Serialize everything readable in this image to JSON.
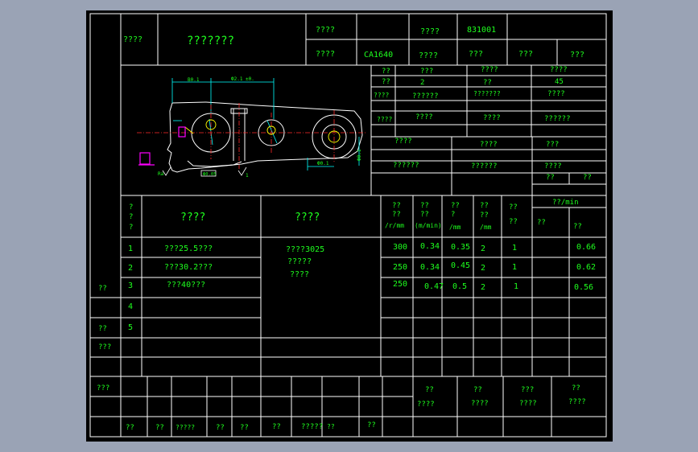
{
  "header": {
    "card_title": "????",
    "process_name": "???????",
    "product_model_label": "????",
    "product_model_value": "",
    "part_number_label": "????",
    "part_number_value": "831001",
    "product_name_label": "????",
    "product_name_value": "CA1640",
    "part_name_label": "????",
    "part_name_value": "???",
    "sheet_label": "???",
    "page_label": "???"
  },
  "info": {
    "r1": [
      "??",
      "???",
      "????",
      "????"
    ],
    "r2": [
      "??",
      "2",
      "??",
      "45"
    ],
    "r3": [
      "????",
      "??????",
      "???????",
      "????"
    ],
    "r4": [
      "????",
      "????",
      "????",
      "??????"
    ],
    "r5": [
      "????",
      "????",
      "???"
    ],
    "r6": [
      "??????",
      "??????",
      "????"
    ],
    "r7": [
      "??",
      "??"
    ]
  },
  "drawing": {
    "dim_left": "B0.1",
    "dim_top": "Ф2.1 ±0.",
    "dim_right": "Ф0.1",
    "dim_vertical": "Ф0.1",
    "box_label": "Ф0.05",
    "mark_left": "Ra",
    "mark_bottom": "1"
  },
  "steps_header": {
    "step_no": [
      "?",
      "?",
      "?"
    ],
    "step_content": "????",
    "equipment": "????",
    "speed": [
      "??",
      "??",
      "/r/mm"
    ],
    "feed": [
      "??",
      "??",
      "(m/min)"
    ],
    "depth": [
      "??",
      "?",
      "/mm"
    ],
    "passes": [
      "??",
      "??",
      "/mm"
    ],
    "count": [
      "??",
      "??"
    ],
    "time_label": "??/min",
    "time_basic": "??",
    "time_aux": "??"
  },
  "steps": [
    {
      "no": "1",
      "content": "???25.5???",
      "speed": "300",
      "feed": "0.34",
      "depth": "0.35",
      "passes": "2",
      "count": "1",
      "time": "0.66"
    },
    {
      "no": "2",
      "content": "???30.2???",
      "speed": "250",
      "feed": "0.34",
      "depth": "0.45",
      "passes": "2",
      "count": "1",
      "time": "0.62"
    },
    {
      "no": "3",
      "content": "???40???",
      "speed": "250",
      "feed": "0.47",
      "depth": "0.5",
      "passes": "2",
      "count": "1",
      "time": "0.56"
    },
    {
      "no": "4"
    },
    {
      "no": "5"
    }
  ],
  "equipment_lines": [
    "????3025",
    "?????",
    "????"
  ],
  "left_col": [
    "??",
    "??",
    "???"
  ],
  "footer": {
    "side_label": "???",
    "sign_top": [
      "??",
      "??",
      "???",
      "??"
    ],
    "sign_bottom": [
      "????",
      "????",
      "????",
      "????"
    ],
    "bottom": [
      "??",
      "??",
      "?????",
      "??",
      "??",
      "??",
      "?????",
      "??",
      "??"
    ]
  },
  "colors": {
    "background": "#9aa3b5",
    "sheet": "#000000",
    "grid_lines": "#ffffff",
    "text": "#1eff1e",
    "part_outline": "#ffffff",
    "dimensions": "#00ffff",
    "center_lines": "#ff2a2a",
    "holes": "#ffff00",
    "fixture": "#ff00ff"
  }
}
